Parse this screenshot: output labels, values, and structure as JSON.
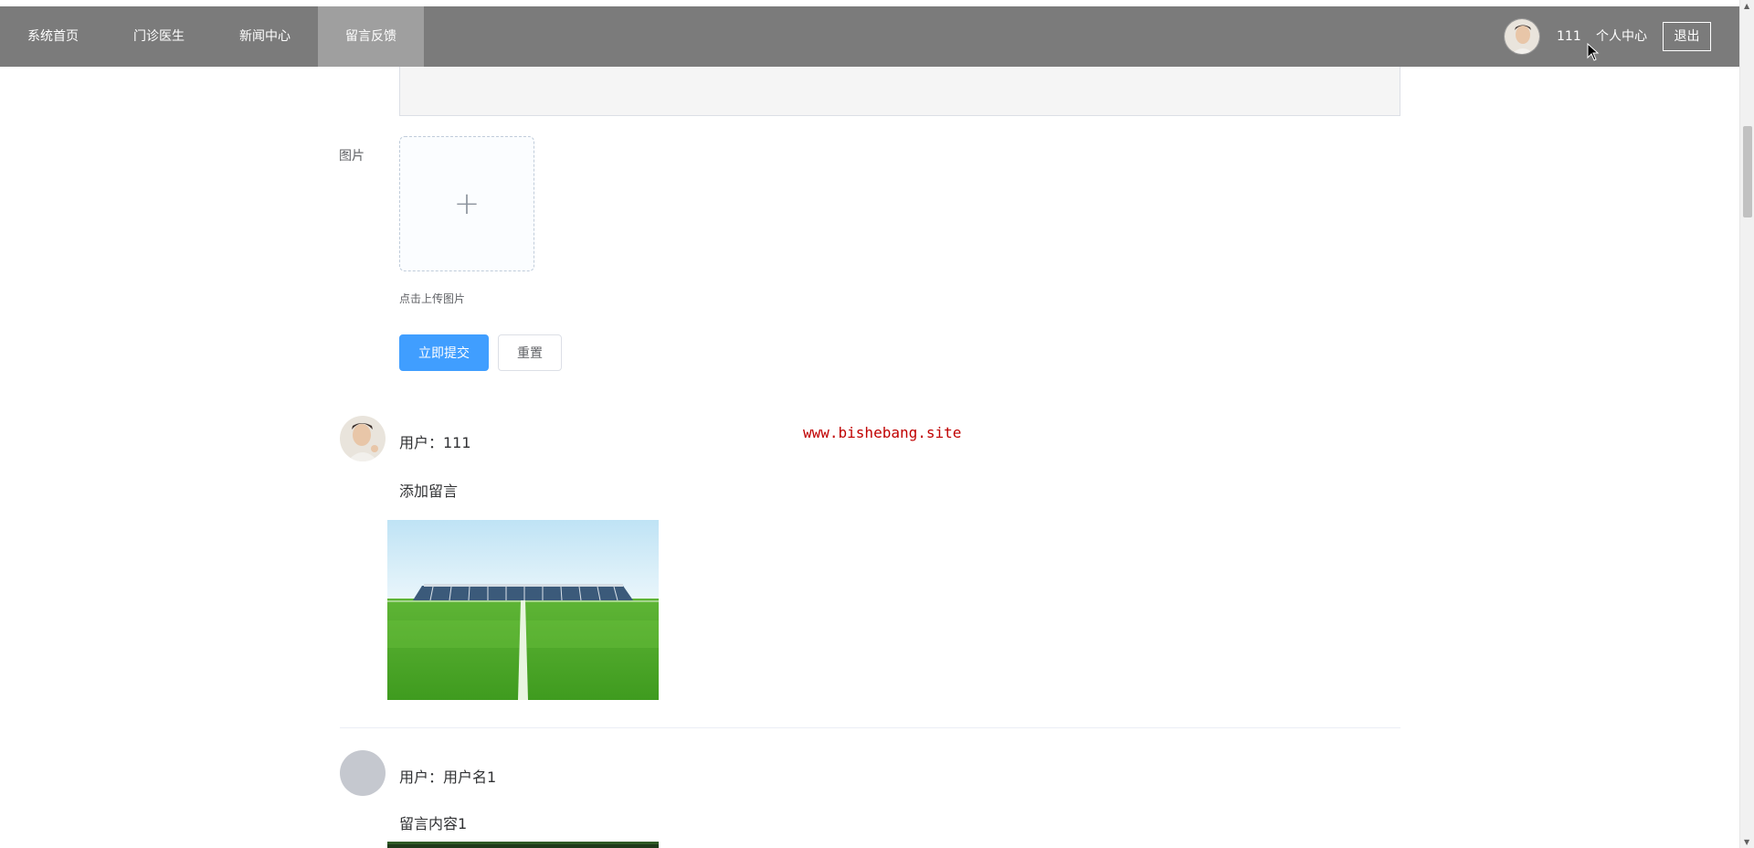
{
  "nav": {
    "items": [
      {
        "label": "系统首页",
        "active": false
      },
      {
        "label": "门诊医生",
        "active": false
      },
      {
        "label": "新闻中心",
        "active": false
      },
      {
        "label": "留言反馈",
        "active": true
      }
    ]
  },
  "user": {
    "name": "111",
    "center_label": "个人中心",
    "logout_label": "退出"
  },
  "form": {
    "image_label": "图片",
    "upload_tip": "点击上传图片",
    "submit_label": "立即提交",
    "reset_label": "重置"
  },
  "watermark": "www.bishebang.site",
  "comments": [
    {
      "user": "用户：111",
      "content": "添加留言",
      "avatar": "user-photo",
      "image": "stadium-photo"
    },
    {
      "user": "用户：用户名1",
      "content": "留言内容1",
      "avatar": "default-gray",
      "image": "forest-photo"
    }
  ],
  "colors": {
    "nav_bg": "#7b7b7b",
    "nav_active": "#9f9f9f",
    "primary": "#409eff",
    "watermark": "#c00000"
  },
  "icons": {
    "upload": "plus-icon",
    "scroll_up": "triangle-up-icon",
    "scroll_down": "triangle-down-icon"
  }
}
